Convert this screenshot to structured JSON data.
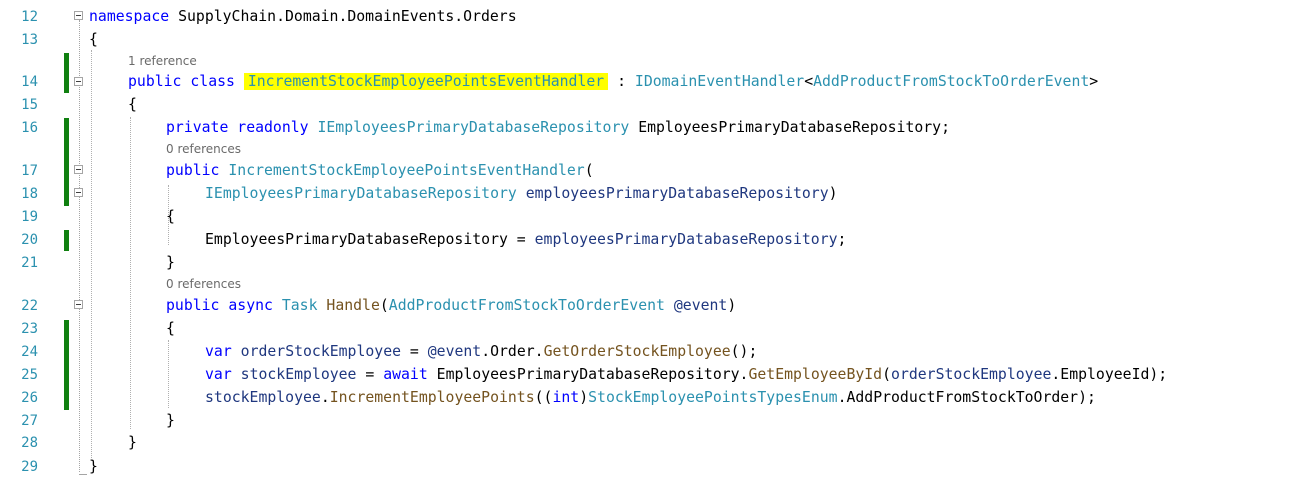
{
  "line_numbers": [
    "12",
    "13",
    "14",
    "15",
    "16",
    "17",
    "18",
    "19",
    "20",
    "21",
    "22",
    "23",
    "24",
    "25",
    "26",
    "27",
    "28",
    "29"
  ],
  "code_lens": {
    "class_refs": "1 reference",
    "ctor_refs": "0 references",
    "handle_refs": "0 references"
  },
  "code": {
    "l12": {
      "kw": "namespace",
      "ns": " SupplyChain.Domain.DomainEvents.Orders"
    },
    "l13": {
      "brace": "{"
    },
    "l14": {
      "kw1": "public",
      "kw2": "class",
      "cls": "IncrementStockEmployeePointsEventHandler",
      "colon": " : ",
      "iface": "IDomainEventHandler",
      "lt": "<",
      "arg": "AddProductFromStockToOrderEvent",
      "gt": ">"
    },
    "l15": {
      "brace": "{"
    },
    "l16": {
      "kw1": "private",
      "kw2": "readonly",
      "type": "IEmployeesPrimaryDatabaseRepository",
      "field": " EmployeesPrimaryDatabaseRepository;"
    },
    "l17": {
      "kw": "public",
      "ctor": "IncrementStockEmployeePointsEventHandler",
      "paren": "("
    },
    "l18": {
      "type": "IEmployeesPrimaryDatabaseRepository",
      "param": "employeesPrimaryDatabaseRepository",
      "close": ")"
    },
    "l19": {
      "brace": "{"
    },
    "l20": {
      "field": "EmployeesPrimaryDatabaseRepository",
      "eq": " = ",
      "param": "employeesPrimaryDatabaseRepository",
      "semi": ";"
    },
    "l21": {
      "brace": "}"
    },
    "l22": {
      "kw1": "public",
      "kw2": "async",
      "task": "Task",
      "method": "Handle",
      "open": "(",
      "argtype": "AddProductFromStockToOrderEvent",
      "param": "@event",
      "close": ")"
    },
    "l23": {
      "brace": "{"
    },
    "l24": {
      "kw": "var",
      "local": "orderStockEmployee",
      "eq": " = ",
      "param": "@event",
      "dot1": ".Order.",
      "method": "GetOrderStockEmployee",
      "tail": "();"
    },
    "l25": {
      "kw": "var",
      "local": "stockEmployee",
      "eq": " = ",
      "await": "await",
      "repo": " EmployeesPrimaryDatabaseRepository.",
      "method": "GetEmployeeById",
      "open": "(",
      "local2": "orderStockEmployee",
      "tail": ".EmployeeId);"
    },
    "l26": {
      "local": "stockEmployee",
      "dot": ".",
      "method": "IncrementEmployeePoints",
      "open": "((",
      "kw": "int",
      "close": ")",
      "enum": "StockEmployeePointsTypesEnum",
      "tail": ".AddProductFromStockToOrder);"
    },
    "l27": {
      "brace": "}"
    },
    "l28": {
      "brace": "}"
    },
    "l29": {
      "brace": "}"
    }
  },
  "colors": {
    "keyword": "#0000ff",
    "type": "#2b91af",
    "parameter": "#1f377f",
    "method": "#74531f",
    "highlight": "#ffff00",
    "change_bar": "#108010",
    "line_number": "#2b91af"
  }
}
